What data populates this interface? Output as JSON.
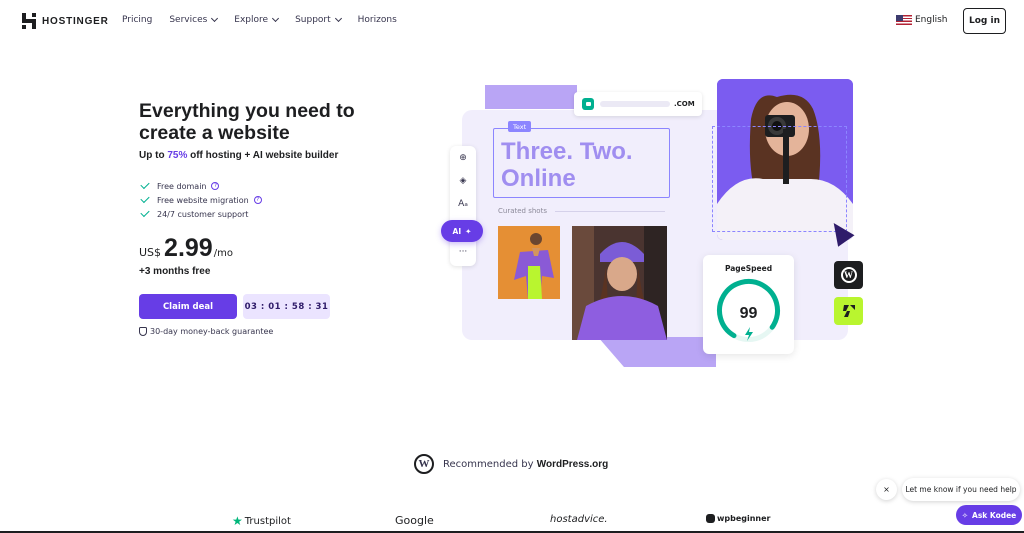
{
  "nav": {
    "logo_text": "HOSTINGER",
    "menu": [
      {
        "label": "Pricing",
        "dropdown": false
      },
      {
        "label": "Services",
        "dropdown": true
      },
      {
        "label": "Explore",
        "dropdown": true
      },
      {
        "label": "Support",
        "dropdown": true
      },
      {
        "label": "Horizons",
        "dropdown": false
      }
    ],
    "language": "English",
    "login_label": "Log in"
  },
  "hero": {
    "title": "Everything you need to create a website",
    "subtitle_prefix": "Up to ",
    "subtitle_highlight": "75%",
    "subtitle_suffix": " off hosting + AI website builder",
    "features": [
      {
        "text": "Free domain",
        "has_info": true
      },
      {
        "text": "Free website migration",
        "has_info": true
      },
      {
        "text": "24/7 customer support",
        "has_info": false
      }
    ],
    "currency": "US$",
    "price": "2.99",
    "per": "/mo",
    "free_months": "+3 months free",
    "claim_label": "Claim deal",
    "timer": "03 : 01 : 58 : 31",
    "guarantee": "30-day money-back guarantee"
  },
  "mockup": {
    "domain_suffix": ".COM",
    "text_tag": "Text",
    "big_text": "Three. Two. Online",
    "curated_label": "Curated shots",
    "ai_label": "AI",
    "pagespeed_title": "PageSpeed",
    "pagespeed_score": "99",
    "pagespeed_fraction": 0.92
  },
  "recommended": {
    "prefix": "Recommended by ",
    "brand": "WordPress.org"
  },
  "partners": [
    "Trustpilot",
    "Google",
    "hostadvice.",
    "wpbeginner"
  ],
  "chat": {
    "close": "×",
    "prompt": "Let me know if you need help",
    "ask_label": "Ask Kodee"
  },
  "colors": {
    "brand_purple": "#673de6",
    "accent_green": "#00b090",
    "lime": "#b9f52f"
  }
}
